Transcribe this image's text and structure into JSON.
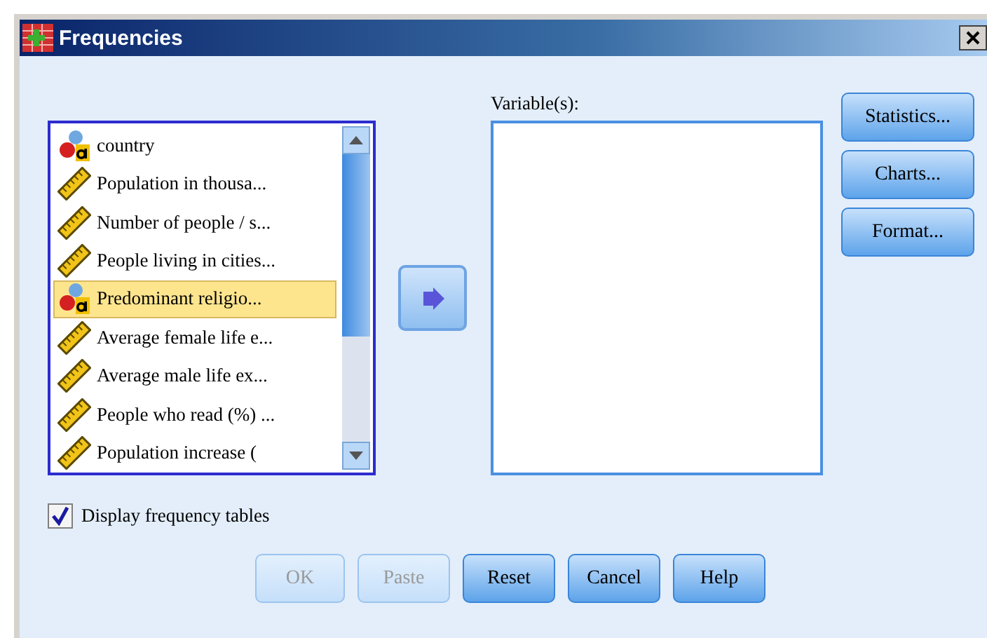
{
  "window": {
    "title": "Frequencies"
  },
  "source_list": {
    "items": [
      {
        "kind": "nominal",
        "label": "country",
        "selected": false
      },
      {
        "kind": "scale",
        "label": "Population in thousa...",
        "selected": false
      },
      {
        "kind": "scale",
        "label": "Number of people / s...",
        "selected": false
      },
      {
        "kind": "scale",
        "label": "People living in cities...",
        "selected": false
      },
      {
        "kind": "nominal",
        "label": "Predominant religio...",
        "selected": true
      },
      {
        "kind": "scale",
        "label": "Average female life e...",
        "selected": false
      },
      {
        "kind": "scale",
        "label": "Average male life ex...",
        "selected": false
      },
      {
        "kind": "scale",
        "label": "People who read (%) ...",
        "selected": false
      },
      {
        "kind": "scale",
        "label": "Population increase (",
        "selected": false
      }
    ]
  },
  "variables": {
    "label": "Variable(s):"
  },
  "side_buttons": [
    "Statistics...",
    "Charts...",
    "Format..."
  ],
  "display_frequency_tables": {
    "label": "Display frequency tables",
    "checked": true
  },
  "buttons": [
    {
      "label": "OK",
      "disabled": true
    },
    {
      "label": "Paste",
      "disabled": true
    },
    {
      "label": "Reset",
      "disabled": false
    },
    {
      "label": "Cancel",
      "disabled": false
    },
    {
      "label": "Help",
      "disabled": false
    }
  ]
}
